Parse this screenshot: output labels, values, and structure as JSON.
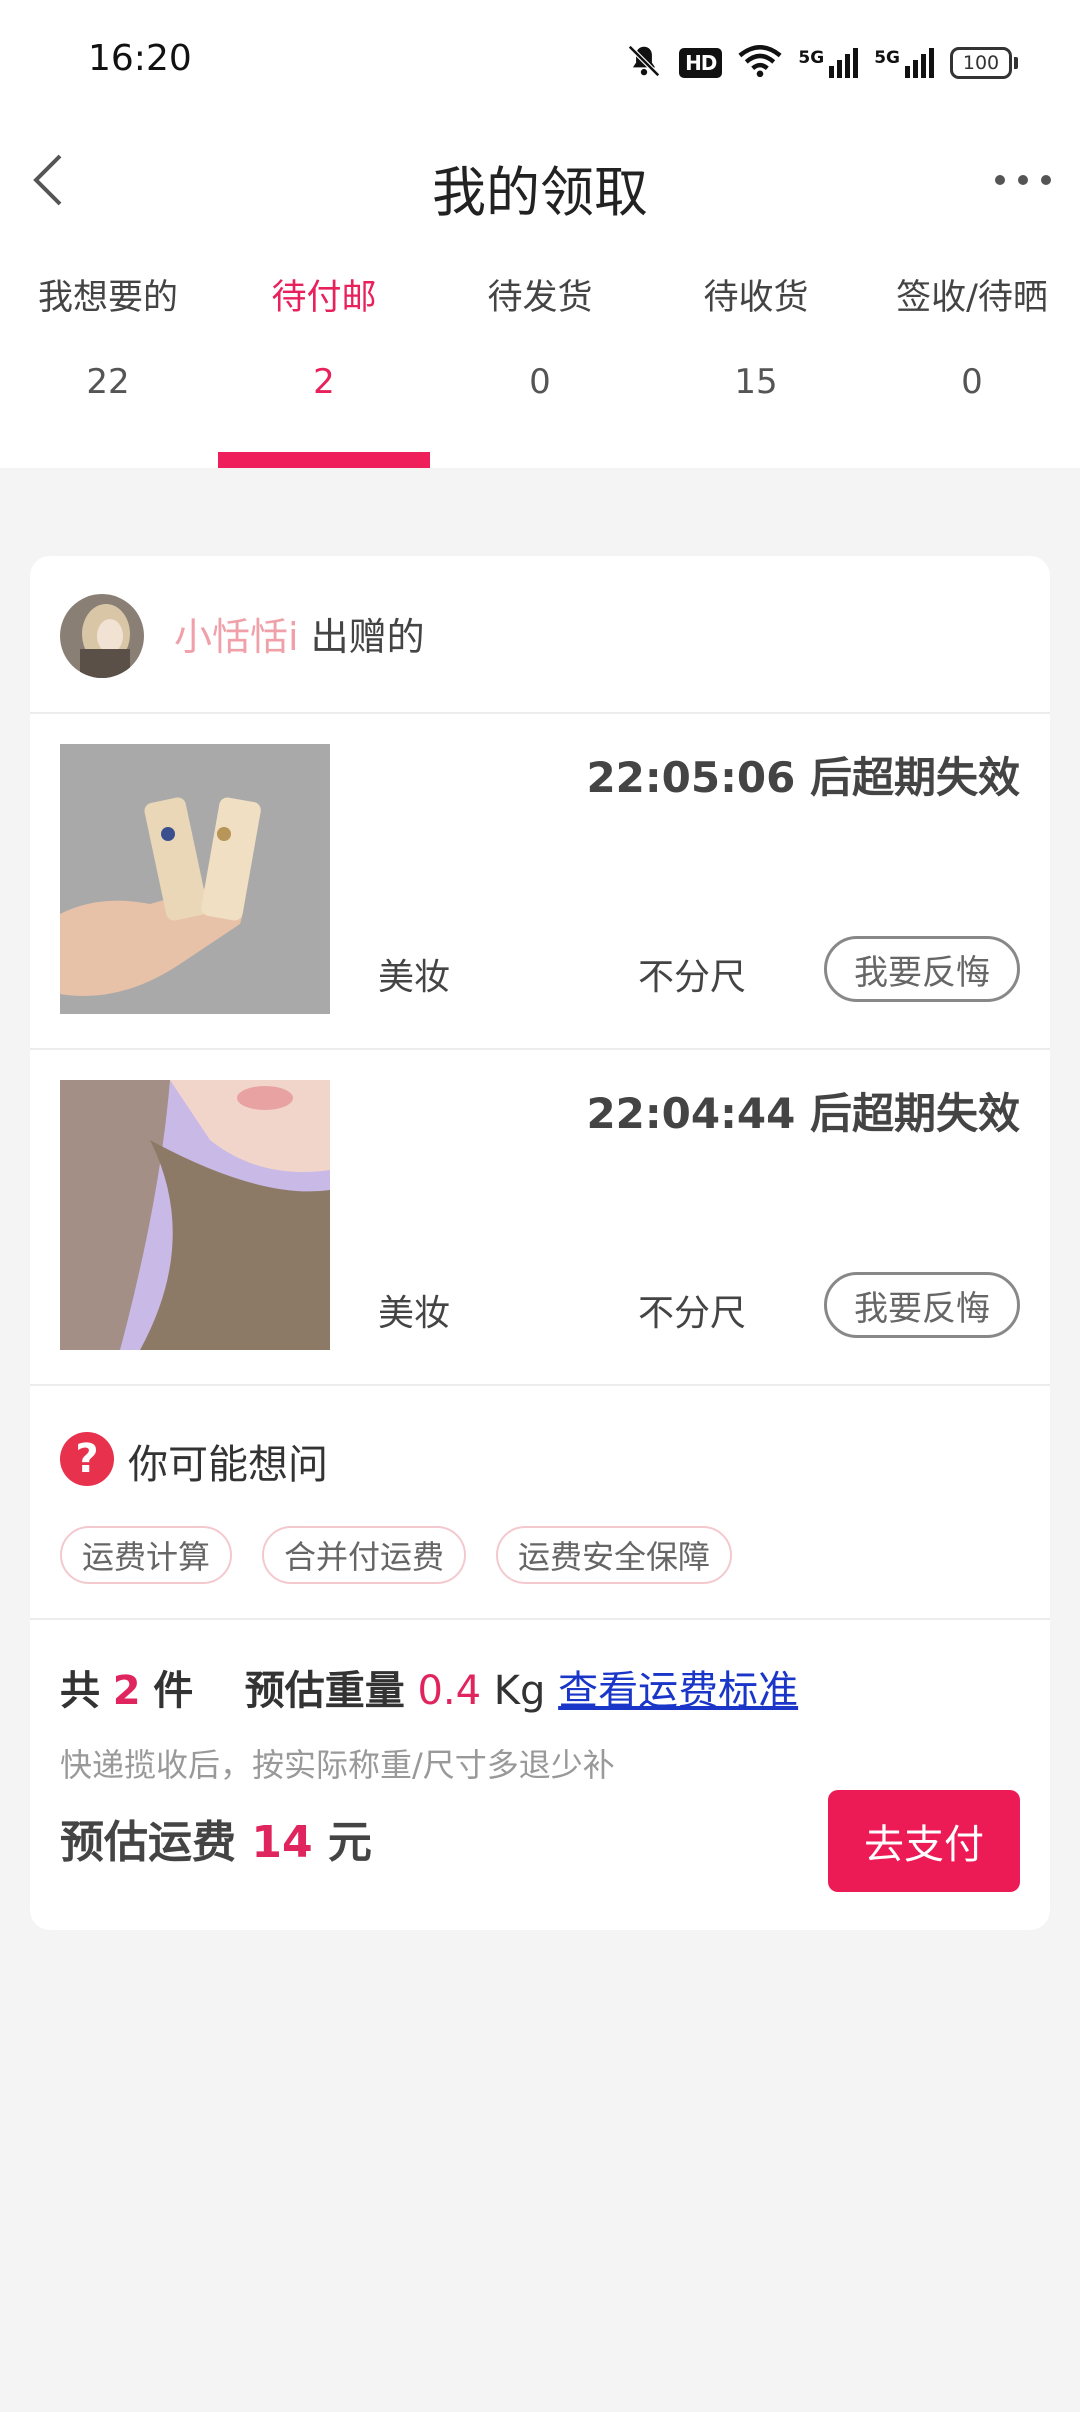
{
  "status_bar": {
    "time": "16:20",
    "icons": [
      "mute-bell-icon",
      "hd-icon",
      "wifi-icon",
      "5g-signal-icon",
      "5g-signal-icon",
      "battery-icon"
    ],
    "hd_label": "HD",
    "network_label": "5G",
    "battery": "100"
  },
  "nav": {
    "title": "我的领取",
    "back_icon": "chevron-left-icon",
    "more_icon": "more-dots-icon"
  },
  "tabs": [
    {
      "label": "我想要的",
      "count": "22"
    },
    {
      "label": "待付邮",
      "count": "2",
      "active": true
    },
    {
      "label": "待发货",
      "count": "0"
    },
    {
      "label": "待收货",
      "count": "15"
    },
    {
      "label": "签收/待晒",
      "count": "0"
    }
  ],
  "seller": {
    "name": "小恬恬i",
    "suffix": " 出赠的"
  },
  "items": [
    {
      "expire": "22:05:06 后超期失效",
      "category": "美妆",
      "size": "不分尺",
      "action": "我要反悔"
    },
    {
      "expire": "22:04:44 后超期失效",
      "category": "美妆",
      "size": "不分尺",
      "action": "我要反悔"
    }
  ],
  "faq": {
    "icon": "question-icon",
    "icon_glyph": "?",
    "title": "你可能想问",
    "chips": [
      "运费计算",
      "合并付运费",
      "运费安全保障"
    ]
  },
  "summary": {
    "count_prefix": "共",
    "count": "2",
    "count_suffix": "件",
    "weight_label": "预估重量",
    "weight_value": "0.4",
    "weight_unit": "Kg",
    "standard_link": "查看运费标准",
    "note": "快递揽收后，按实际称重/尺寸多退少补",
    "fee_label": "预估运费",
    "fee_value": "14",
    "fee_unit": "元",
    "pay_button": "去支付"
  },
  "colors": {
    "accent": "#ec1b55",
    "seller_name": "#f0a0a8",
    "link": "#1a36c8"
  }
}
